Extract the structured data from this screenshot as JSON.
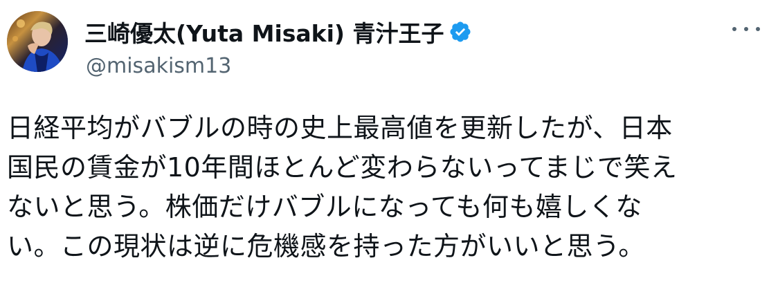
{
  "author": {
    "display_name": "三崎優太(Yuta Misaki) 青汁王子",
    "handle": "@misakism13",
    "verified_icon": "verified-badge-icon",
    "verified_color": "#1d9bf0"
  },
  "menu": {
    "icon": "more-horizontal-icon"
  },
  "tweet": {
    "lines": [
      "日経平均がバブルの時の史上最高値を更新したが、日本",
      "国民の賃金が10年間ほとんど変わらないってまじで笑え",
      "ないと思う。株価だけバブルになっても何も嬉しくな",
      "い。この現状は逆に危機感を持った方がいいと思う。"
    ]
  }
}
